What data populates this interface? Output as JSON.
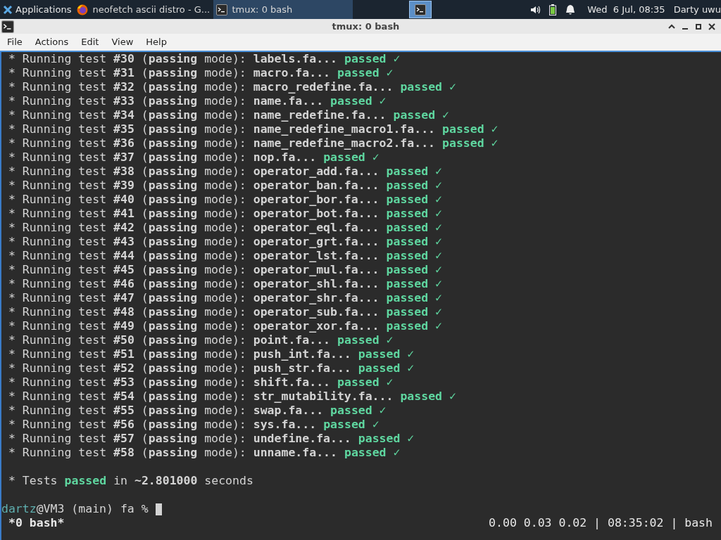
{
  "taskbar": {
    "apps_label": "Applications",
    "tasks": [
      {
        "kind": "browser",
        "label": "neofetch ascii distro - G...",
        "selected": false
      },
      {
        "kind": "terminal",
        "label": "tmux: 0 bash",
        "selected": true
      }
    ],
    "clock": "Wed  6 Jul, 08:35",
    "user": "Darty uwu"
  },
  "window": {
    "title": "tmux: 0 bash"
  },
  "menu": [
    "File",
    "Actions",
    "Edit",
    "View",
    "Help"
  ],
  "terminal": {
    "lines": [
      {
        "text": "* Running test **#30** (**passing** mode): **labels.fa...**",
        "result": "passed ✓"
      },
      {
        "text": "* Running test **#31** (**passing** mode): **macro.fa...**",
        "result": "passed ✓"
      },
      {
        "text": "* Running test **#32** (**passing** mode): **macro_redefine.fa...**",
        "result": "passed ✓"
      },
      {
        "text": "* Running test **#33** (**passing** mode): **name.fa...**",
        "result": "passed ✓"
      },
      {
        "text": "* Running test **#34** (**passing** mode): **name_redefine.fa...**",
        "result": "passed ✓"
      },
      {
        "text": "* Running test **#35** (**passing** mode): **name_redefine_macro1.fa...**",
        "result": "passed ✓"
      },
      {
        "text": "* Running test **#36** (**passing** mode): **name_redefine_macro2.fa...**",
        "result": "passed ✓"
      },
      {
        "text": "* Running test **#37** (**passing** mode): **nop.fa...**",
        "result": "passed ✓"
      },
      {
        "text": "* Running test **#38** (**passing** mode): **operator_add.fa...**",
        "result": "passed ✓"
      },
      {
        "text": "* Running test **#39** (**passing** mode): **operator_ban.fa...**",
        "result": "passed ✓"
      },
      {
        "text": "* Running test **#40** (**passing** mode): **operator_bor.fa...**",
        "result": "passed ✓"
      },
      {
        "text": "* Running test **#41** (**passing** mode): **operator_bot.fa...**",
        "result": "passed ✓"
      },
      {
        "text": "* Running test **#42** (**passing** mode): **operator_eql.fa...**",
        "result": "passed ✓"
      },
      {
        "text": "* Running test **#43** (**passing** mode): **operator_grt.fa...**",
        "result": "passed ✓"
      },
      {
        "text": "* Running test **#44** (**passing** mode): **operator_lst.fa...**",
        "result": "passed ✓"
      },
      {
        "text": "* Running test **#45** (**passing** mode): **operator_mul.fa...**",
        "result": "passed ✓"
      },
      {
        "text": "* Running test **#46** (**passing** mode): **operator_shl.fa...**",
        "result": "passed ✓"
      },
      {
        "text": "* Running test **#47** (**passing** mode): **operator_shr.fa...**",
        "result": "passed ✓"
      },
      {
        "text": "* Running test **#48** (**passing** mode): **operator_sub.fa...**",
        "result": "passed ✓"
      },
      {
        "text": "* Running test **#49** (**passing** mode): **operator_xor.fa...**",
        "result": "passed ✓"
      },
      {
        "text": "* Running test **#50** (**passing** mode): **point.fa...**",
        "result": "passed ✓"
      },
      {
        "text": "* Running test **#51** (**passing** mode): **push_int.fa...**",
        "result": "passed ✓"
      },
      {
        "text": "* Running test **#52** (**passing** mode): **push_str.fa...**",
        "result": "passed ✓"
      },
      {
        "text": "* Running test **#53** (**passing** mode): **shift.fa...**",
        "result": "passed ✓"
      },
      {
        "text": "* Running test **#54** (**passing** mode): **str_mutability.fa...**",
        "result": "passed ✓"
      },
      {
        "text": "* Running test **#55** (**passing** mode): **swap.fa...**",
        "result": "passed ✓"
      },
      {
        "text": "* Running test **#56** (**passing** mode): **sys.fa...**",
        "result": "passed ✓"
      },
      {
        "text": "* Running test **#57** (**passing** mode): **undefine.fa...**",
        "result": "passed ✓"
      },
      {
        "text": "* Running test **#58** (**passing** mode): **unname.fa...**",
        "result": "passed ✓"
      }
    ],
    "summary": {
      "prefix": "* Tests",
      "status": "passed",
      "suffix": "in **~2.801000** seconds"
    },
    "prompt": {
      "user": "dartz",
      "rest": "@VM3 (main) fa %"
    }
  },
  "status_bar": {
    "session": "*0 bash*",
    "info": "0.00 0.03 0.02 | 08:35:02 | bash"
  }
}
